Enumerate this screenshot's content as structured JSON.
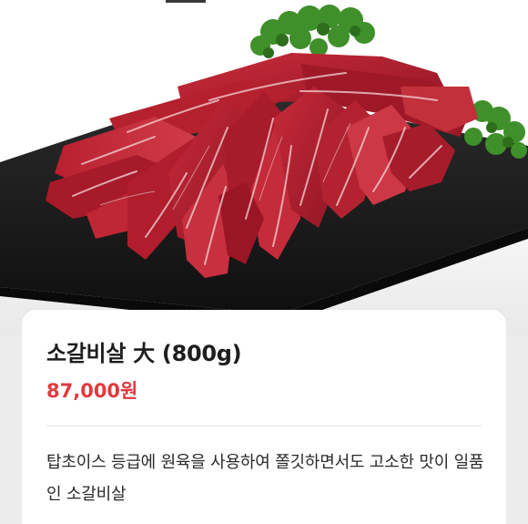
{
  "product": {
    "name": "소갈비살 大 (800g)",
    "price": "87,000원",
    "description": "탑초이스 등급에 원육을 사용하여 쫄깃하면서도 고소한 맛이 일품인 소갈비살"
  },
  "colors": {
    "price": "#e03a3e",
    "background": "#ececec",
    "card": "#ffffff",
    "tab_indicator": "#3a3a3a"
  }
}
